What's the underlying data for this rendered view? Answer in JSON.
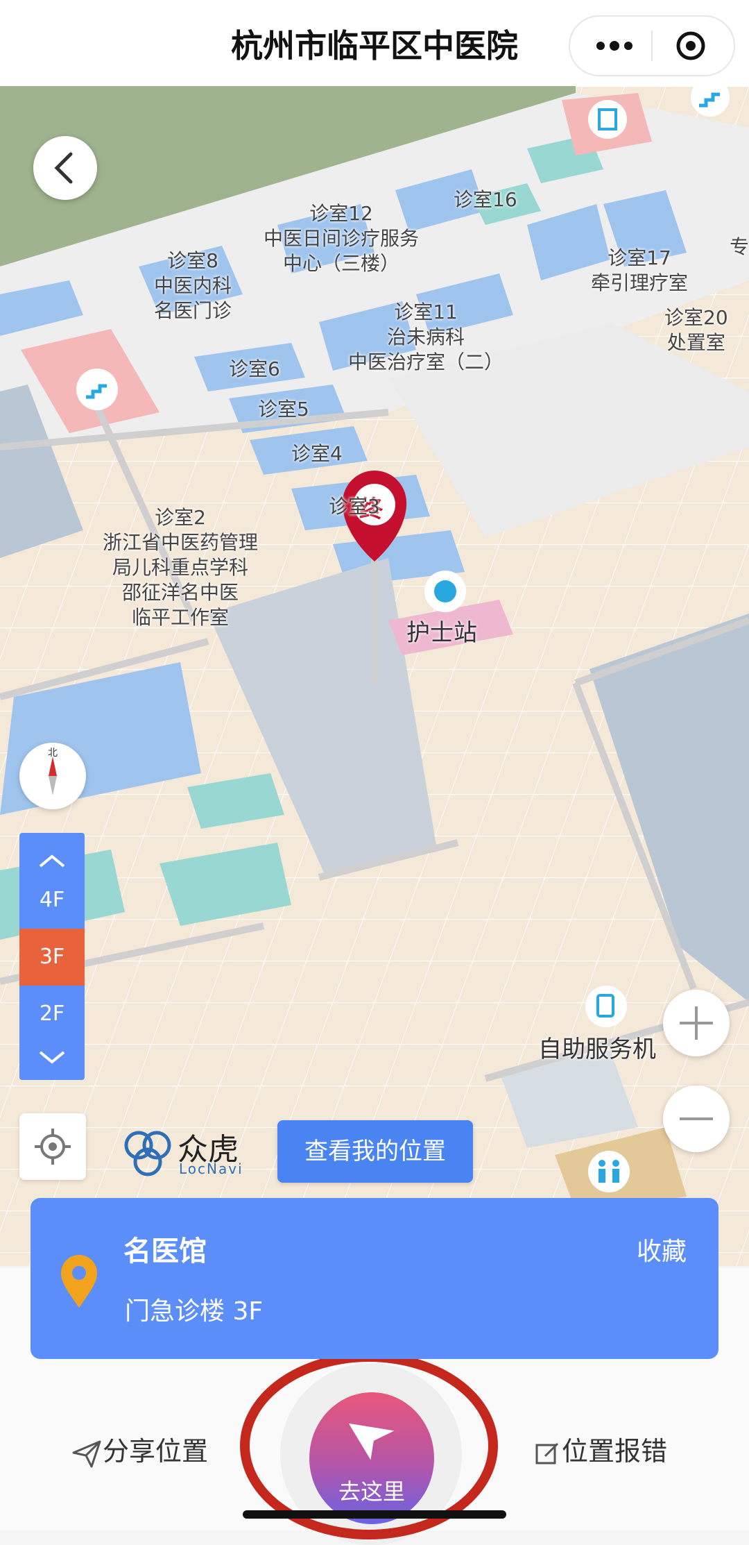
{
  "titlebar": {
    "title": "杭州市临平区中医院"
  },
  "map": {
    "rooms": [
      {
        "lines": [
          "诊室12",
          "中医日间诊疗服务",
          "中心（三楼）"
        ]
      },
      {
        "lines": [
          "诊室16"
        ]
      },
      {
        "lines": [
          "诊室8",
          "中医内科",
          "名医门诊"
        ]
      },
      {
        "lines": [
          "诊室17",
          "牵引理疗室"
        ]
      },
      {
        "lines": [
          "诊室20",
          "处置室"
        ]
      },
      {
        "lines": [
          "诊室11",
          "治未病科",
          "中医治疗室（二）"
        ]
      },
      {
        "lines": [
          "诊室6"
        ]
      },
      {
        "lines": [
          "诊室5"
        ]
      },
      {
        "lines": [
          "诊室4"
        ]
      },
      {
        "lines": [
          "诊室3"
        ]
      },
      {
        "lines": [
          "诊室2",
          "浙江省中医药管理",
          "局儿科重点学科",
          "邵征洋名中医",
          "临平工作室"
        ]
      },
      {
        "lines": [
          "专"
        ]
      }
    ],
    "nurse_station": "护士站",
    "self_service": "自助服务机",
    "end_marker": "终",
    "compass_north": "北",
    "floors": [
      "4F",
      "3F",
      "2F"
    ],
    "active_floor": "3F",
    "brand_cn": "众虎",
    "brand_en": "LocNavi",
    "my_location_button": "查看我的位置"
  },
  "card": {
    "name": "名医馆",
    "location": "门急诊楼 3F",
    "favorite": "收藏"
  },
  "bottom": {
    "share": "分享位置",
    "go": "去这里",
    "report": "位置报错"
  },
  "colors": {
    "primary": "#5b8ef8",
    "active_floor": "#e8623b",
    "marker_red": "#c4102e",
    "highlight_ring": "#c4271b",
    "pin_orange": "#f2a31e"
  }
}
